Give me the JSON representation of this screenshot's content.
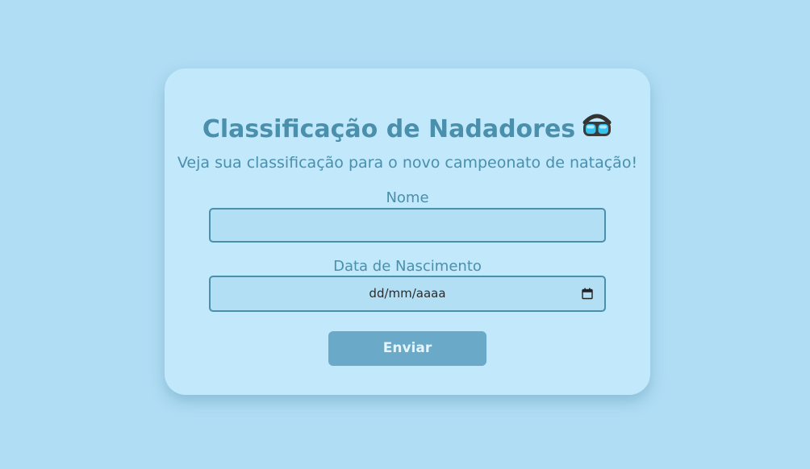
{
  "form": {
    "title": "Classificação de Nadadores",
    "title_icon": "swim-goggles-icon",
    "subtitle": "Veja sua classificação para o novo campeonato de natação!",
    "name_label": "Nome",
    "name_value": "",
    "birthdate_label": "Data de Nascimento",
    "birthdate_placeholder": "dd/mm/aaaa",
    "calendar_icon": "calendar-icon",
    "submit_label": "Enviar"
  },
  "colors": {
    "background": "#b0ddf4",
    "card": "#c2e8fb",
    "text": "#4a8fac",
    "input_background": "#b3dff5",
    "button": "#6aa9c7",
    "button_text": "#e3f5ff"
  }
}
